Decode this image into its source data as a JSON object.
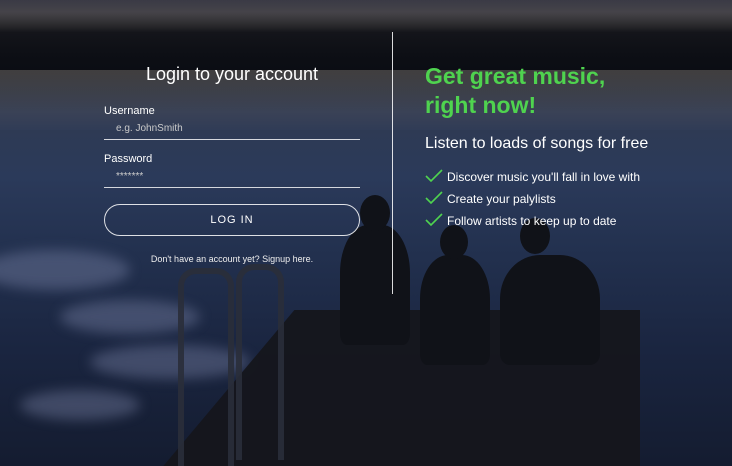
{
  "login": {
    "title": "Login to your account",
    "username_label": "Username",
    "username_placeholder": "e.g. JohnSmith",
    "password_label": "Password",
    "password_value": "*******",
    "login_button": "LOG IN",
    "signup_text": "Don't have an account yet? Signup here."
  },
  "promo": {
    "headline_line1": "Get great music,",
    "headline_line2": "right now!",
    "subtitle": "Listen to loads of songs for free",
    "features": [
      "Discover music you'll fall in love with",
      "Create your palylists",
      "Follow artists to keep up to date"
    ]
  },
  "colors": {
    "accent": "#4fd34f"
  },
  "icons": {
    "feature_icon": "checkmark-icon"
  }
}
